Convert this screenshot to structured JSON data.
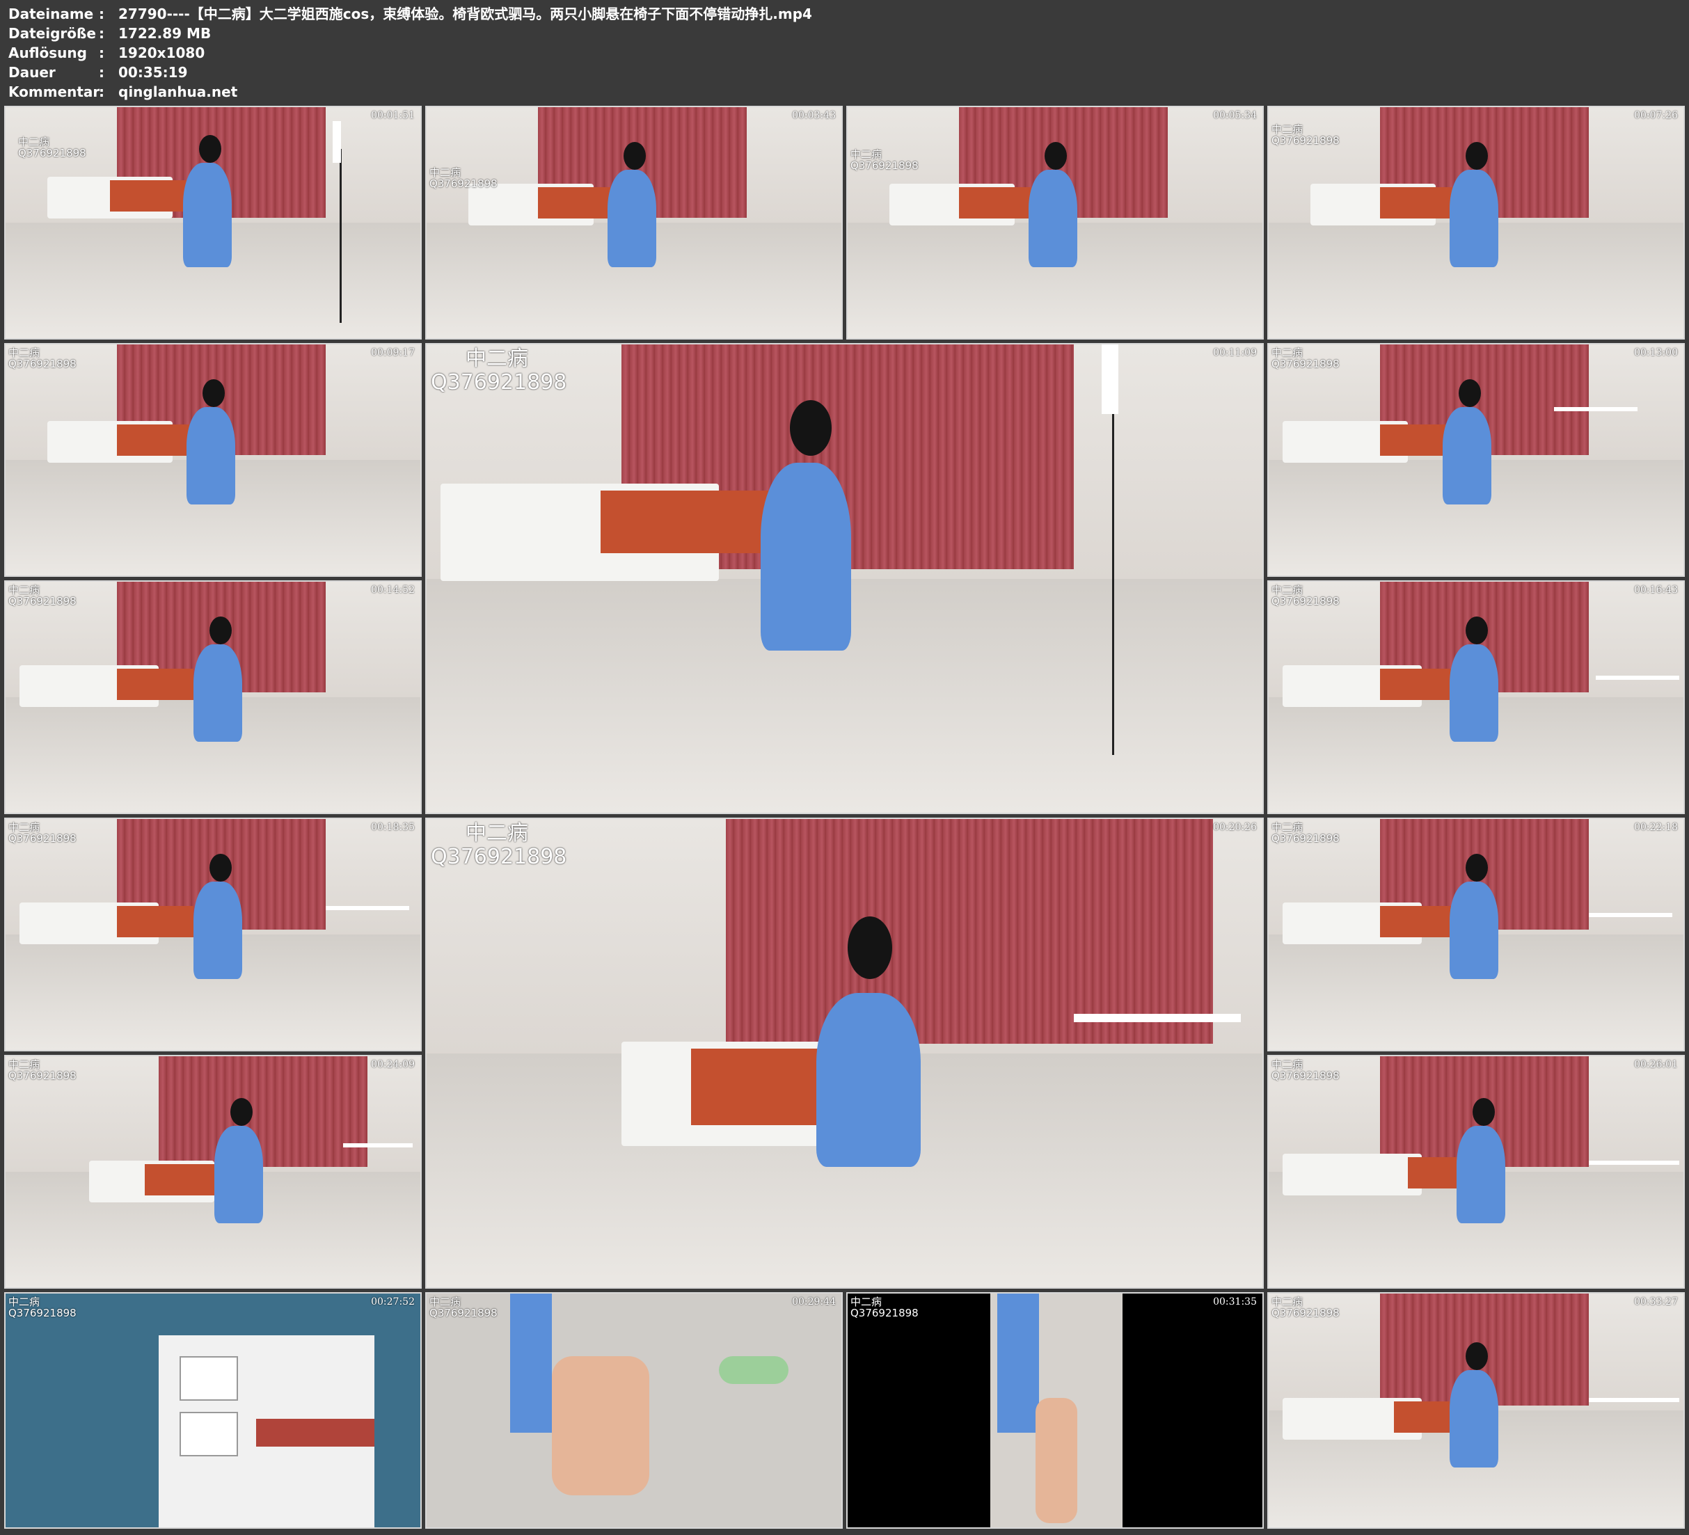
{
  "meta": {
    "filename_label": "Dateiname",
    "filename": "27790----【中二病】大二学姐西施cos，束缚体验。椅背欧式驷马。两只小脚悬在椅子下面不停错动挣扎.mp4",
    "size_label": "Dateigröße",
    "size": "1722.89 MB",
    "resolution_label": "Auflösung",
    "resolution": "1920x1080",
    "duration_label": "Dauer",
    "duration": "00:35:19",
    "comment_label": "Kommentar",
    "comment": "qinglanhua.net",
    "separator": ":"
  },
  "watermark": {
    "line1": "中二病",
    "line2": "Q376921898"
  },
  "thumbnails": [
    {
      "time": "00:01:51"
    },
    {
      "time": "00:03:43"
    },
    {
      "time": "00:05:34"
    },
    {
      "time": "00:07:26"
    },
    {
      "time": "00:09:17"
    },
    {
      "time": "00:11:09"
    },
    {
      "time": "00:13:00"
    },
    {
      "time": "00:14:52"
    },
    {
      "time": "00:16:43"
    },
    {
      "time": "00:18:35"
    },
    {
      "time": "00:20:26"
    },
    {
      "time": "00:22:18"
    },
    {
      "time": "00:24:09"
    },
    {
      "time": "00:26:01"
    },
    {
      "time": "00:27:52"
    },
    {
      "time": "00:29:44"
    },
    {
      "time": "00:31:35"
    },
    {
      "time": "00:33:27"
    }
  ]
}
